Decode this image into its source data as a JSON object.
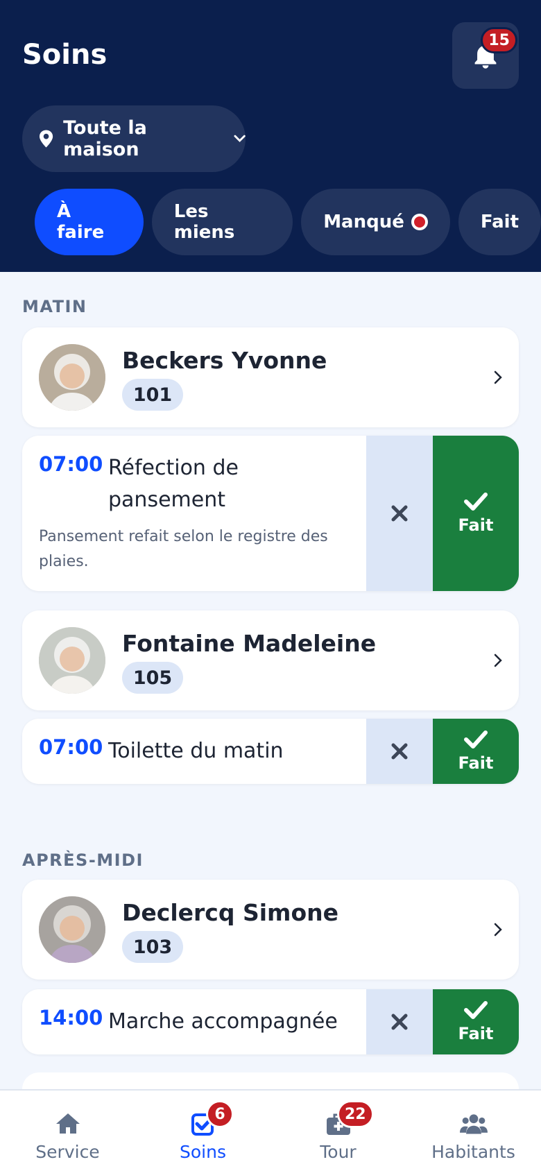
{
  "header": {
    "title": "Soins",
    "notifications_count": "15",
    "location": "Toute la maison"
  },
  "tabs": [
    {
      "label": "À faire",
      "active": true
    },
    {
      "label": "Les miens",
      "active": false
    },
    {
      "label": "Manqué",
      "active": false,
      "alert": true
    },
    {
      "label": "Fait",
      "active": false
    }
  ],
  "sections": [
    {
      "label": "MATIN",
      "groups": [
        {
          "resident": {
            "name": "Beckers Yvonne",
            "room": "101"
          },
          "task": {
            "time": "07:00",
            "name": "Réfection de pansement",
            "note": "Pansement refait selon le registre des plaies.",
            "done_label": "Fait"
          }
        },
        {
          "resident": {
            "name": "Fontaine Madeleine",
            "room": "105"
          },
          "task": {
            "time": "07:00",
            "name": "Toilette du matin",
            "done_label": "Fait"
          }
        }
      ]
    },
    {
      "label": "APRÈS-MIDI",
      "groups": [
        {
          "resident": {
            "name": "Declercq Simone",
            "room": "103"
          },
          "task": {
            "time": "14:00",
            "name": "Marche accompagnée",
            "done_label": "Fait"
          }
        }
      ]
    }
  ],
  "navbar": [
    {
      "label": "Service",
      "icon": "home-icon",
      "active": false
    },
    {
      "label": "Soins",
      "icon": "check-square-icon",
      "active": true,
      "badge": "6"
    },
    {
      "label": "Tour",
      "icon": "medical-kit-icon",
      "active": false,
      "badge": "22"
    },
    {
      "label": "Habitants",
      "icon": "users-icon",
      "active": false
    }
  ],
  "colors": {
    "header_bg": "#0b1f4d",
    "accent": "#0f4dff",
    "done_green": "#1a7f3e",
    "badge_red": "#c41e24"
  }
}
